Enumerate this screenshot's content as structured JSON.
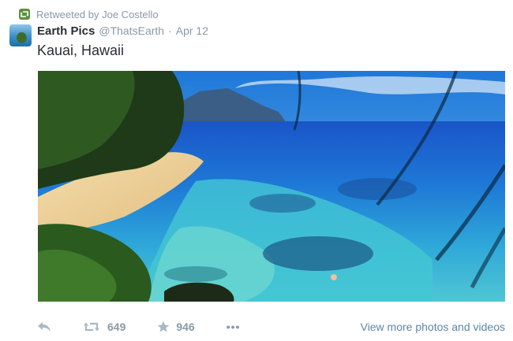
{
  "retweet_context": {
    "text": "Retweeted by Joe Costello",
    "icon": "retweet-icon"
  },
  "tweet": {
    "author_name": "Earth Pics",
    "author_handle": "@ThatsEarth",
    "separator": "·",
    "time": "Apr 12",
    "text": "Kauai, Hawaii",
    "photo_subject": "tropical-beach-photo"
  },
  "actions": {
    "reply_icon": "reply-icon",
    "retweet_icon": "retweet-icon",
    "retweet_count": "649",
    "favorite_icon": "star-icon",
    "favorite_count": "946",
    "more_label": "•••",
    "view_more_label": "View more photos and videos"
  },
  "colors": {
    "retweet_badge": "#5c913b",
    "muted_text": "#8899a6",
    "link": "#5a87a8",
    "text": "#292f33"
  }
}
